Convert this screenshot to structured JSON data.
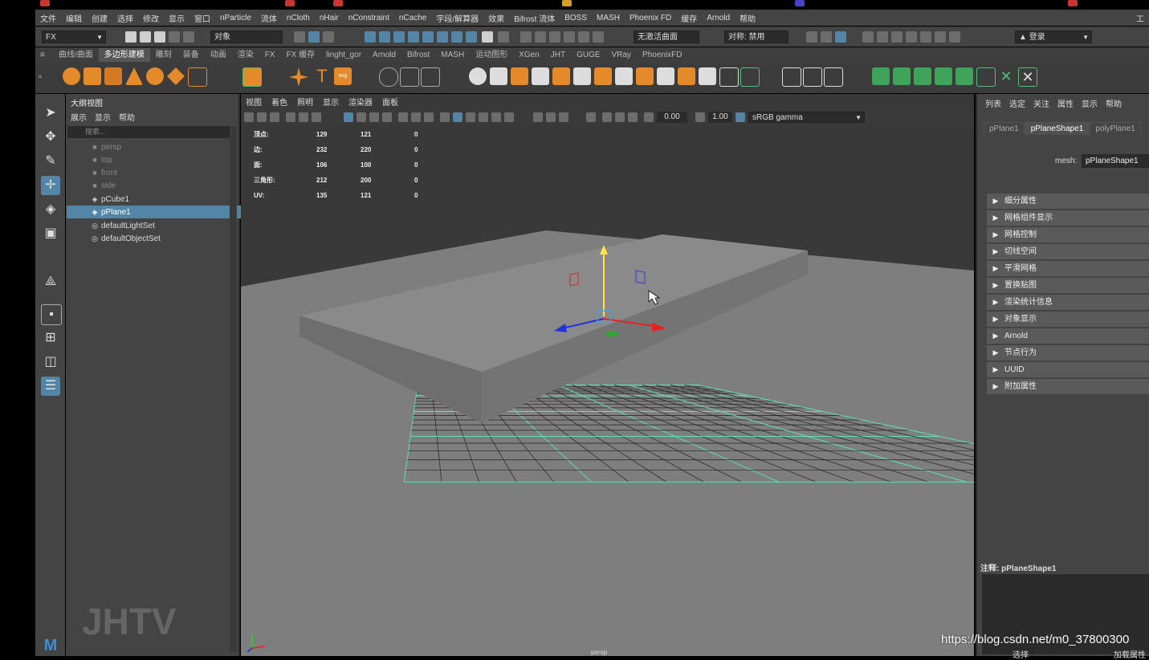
{
  "menubar": {
    "items": [
      "文件",
      "编辑",
      "创建",
      "选择",
      "修改",
      "显示",
      "窗口",
      "nParticle",
      "流体",
      "nCloth",
      "nHair",
      "nConstraint",
      "nCache",
      "字段/解算器",
      "效果",
      "Bifrost 流体",
      "BOSS",
      "MASH",
      "Phoenix FD",
      "缓存",
      "Arnold",
      "帮助"
    ],
    "right_label": "工"
  },
  "statusline": {
    "mode": "FX",
    "object_label": "对象",
    "live_surface": "无激活曲面",
    "symmetry": "对称: 禁用",
    "login": "登录"
  },
  "shelf": {
    "tabs": [
      "曲线/曲面",
      "多边形建模",
      "雕刻",
      "装备",
      "动画",
      "渲染",
      "FX",
      "FX 缓存",
      "linght_gor",
      "Arnold",
      "Bifrost",
      "MASH",
      "运动图形",
      "XGen",
      "JHT",
      "GUGE",
      "VRay",
      "PhoenixFD"
    ],
    "active_tab": "多边形建模"
  },
  "outliner": {
    "title": "大纲视图",
    "menu": [
      "展示",
      "显示",
      "帮助"
    ],
    "search_placeholder": "搜索...",
    "items": [
      {
        "label": "persp",
        "icon": "camera-icon",
        "dim": true
      },
      {
        "label": "top",
        "icon": "camera-icon",
        "dim": true
      },
      {
        "label": "front",
        "icon": "camera-icon",
        "dim": true
      },
      {
        "label": "side",
        "icon": "camera-icon",
        "dim": true
      },
      {
        "label": "pCube1",
        "icon": "mesh-icon",
        "dim": false
      },
      {
        "label": "pPlane1",
        "icon": "mesh-icon",
        "dim": false,
        "selected": true
      },
      {
        "label": "defaultLightSet",
        "icon": "set-icon",
        "dim": false
      },
      {
        "label": "defaultObjectSet",
        "icon": "set-icon",
        "dim": false
      }
    ]
  },
  "viewport": {
    "menu": [
      "视图",
      "着色",
      "照明",
      "显示",
      "渲染器",
      "面板"
    ],
    "exposure": "0.00",
    "gamma": "1.00",
    "color_space": "sRGB gamma",
    "camera_label": "persp",
    "hud": [
      {
        "label": "顶点:",
        "a": "129",
        "b": "121",
        "c": "0"
      },
      {
        "label": "边:",
        "a": "232",
        "b": "220",
        "c": "0"
      },
      {
        "label": "面:",
        "a": "106",
        "b": "100",
        "c": "0"
      },
      {
        "label": "三角形:",
        "a": "212",
        "b": "200",
        "c": "0"
      },
      {
        "label": "UV:",
        "a": "135",
        "b": "121",
        "c": "0"
      }
    ]
  },
  "attribute_editor": {
    "menu": [
      "列表",
      "选定",
      "关注",
      "属性",
      "显示",
      "帮助"
    ],
    "tabs": [
      "pPlane1",
      "pPlaneShape1",
      "polyPlane1"
    ],
    "active_tab": "pPlaneShape1",
    "mesh_label": "mesh:",
    "mesh_value": "pPlaneShape1",
    "sections": [
      "细分属性",
      "网格组件显示",
      "网格控制",
      "切线空间",
      "平滑网格",
      "置换贴图",
      "渲染统计信息",
      "对象显示",
      "Arnold",
      "节点行为",
      "UUID",
      "附加属性"
    ],
    "notes_label": "注释: pPlaneShape1",
    "bottom_left": "选择",
    "bottom_right": "加载属性"
  },
  "watermark": {
    "url": "https://blog.csdn.net/m0_37800300",
    "logo": "JHTV"
  }
}
